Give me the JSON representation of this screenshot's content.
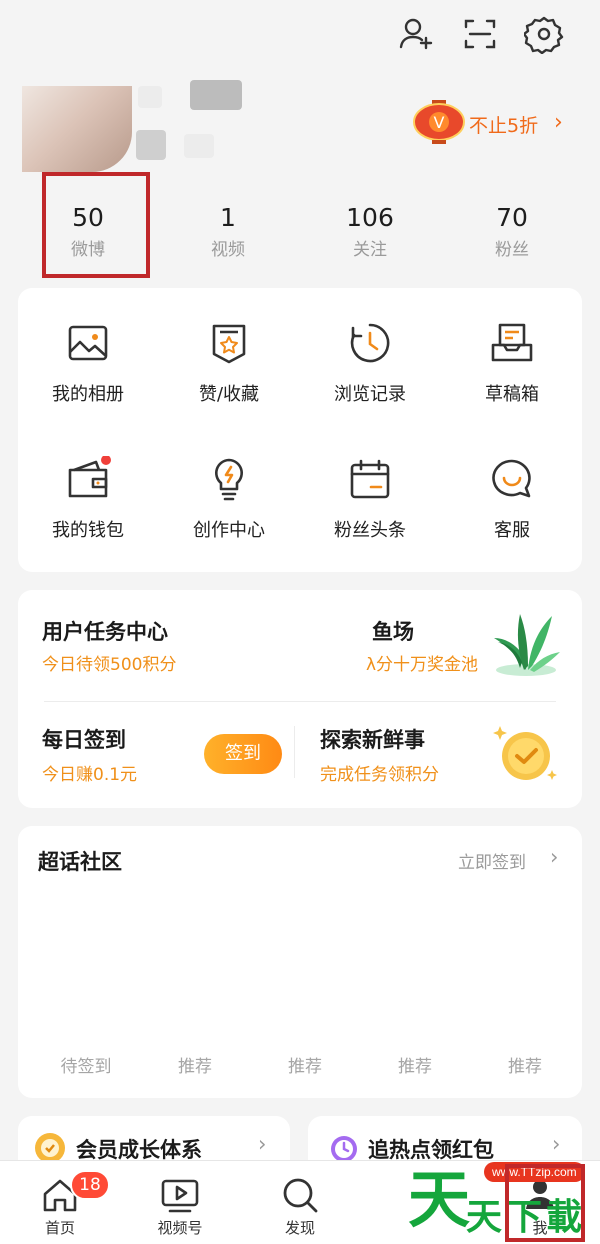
{
  "header": {
    "icons": [
      "add-friend-icon",
      "scan-icon",
      "settings-icon"
    ]
  },
  "promo": {
    "label": "不止5折",
    "badge_letter": "V"
  },
  "stats": [
    {
      "num": "50",
      "label": "微博"
    },
    {
      "num": "1",
      "label": "视频"
    },
    {
      "num": "106",
      "label": "关注"
    },
    {
      "num": "70",
      "label": "粉丝"
    }
  ],
  "features": [
    {
      "label": "我的相册",
      "icon": "photo-album-icon"
    },
    {
      "label": "赞/收藏",
      "icon": "favorites-icon"
    },
    {
      "label": "浏览记录",
      "icon": "history-icon"
    },
    {
      "label": "草稿箱",
      "icon": "drafts-icon"
    },
    {
      "label": "我的钱包",
      "icon": "wallet-icon"
    },
    {
      "label": "创作中心",
      "icon": "lightbulb-icon"
    },
    {
      "label": "粉丝头条",
      "icon": "calendar-icon"
    },
    {
      "label": "客服",
      "icon": "customer-service-icon"
    }
  ],
  "tasks": {
    "center_title": "用户任务中心",
    "center_sub": "今日待领500积分",
    "fish_title": "鱼场",
    "fish_sub": "λ分十万奖金池",
    "checkin_title": "每日签到",
    "checkin_sub": "今日赚0.1元",
    "checkin_button": "签到",
    "explore_title": "探索新鲜事",
    "explore_sub": "完成任务领积分"
  },
  "super_topic": {
    "title": "超话社区",
    "link": "立即签到",
    "tabs": [
      "待签到",
      "推荐",
      "推荐",
      "推荐",
      "推荐"
    ]
  },
  "bottom_cards": [
    {
      "label": "会员成长体系"
    },
    {
      "label": "追热点领红包"
    }
  ],
  "bottom_nav": {
    "items": [
      {
        "label": "首页",
        "icon": "home-icon"
      },
      {
        "label": "视频号",
        "icon": "video-icon"
      },
      {
        "label": "发现",
        "icon": "search-icon"
      },
      {
        "label": "我",
        "icon": "profile-icon"
      }
    ],
    "home_badge": "18"
  },
  "watermark": {
    "url": "www.TTzip.com",
    "big": "天",
    "small": "天下載"
  },
  "colors": {
    "accent": "#f0901a",
    "highlight_box": "#c0282a",
    "badge": "#ff4a36"
  }
}
